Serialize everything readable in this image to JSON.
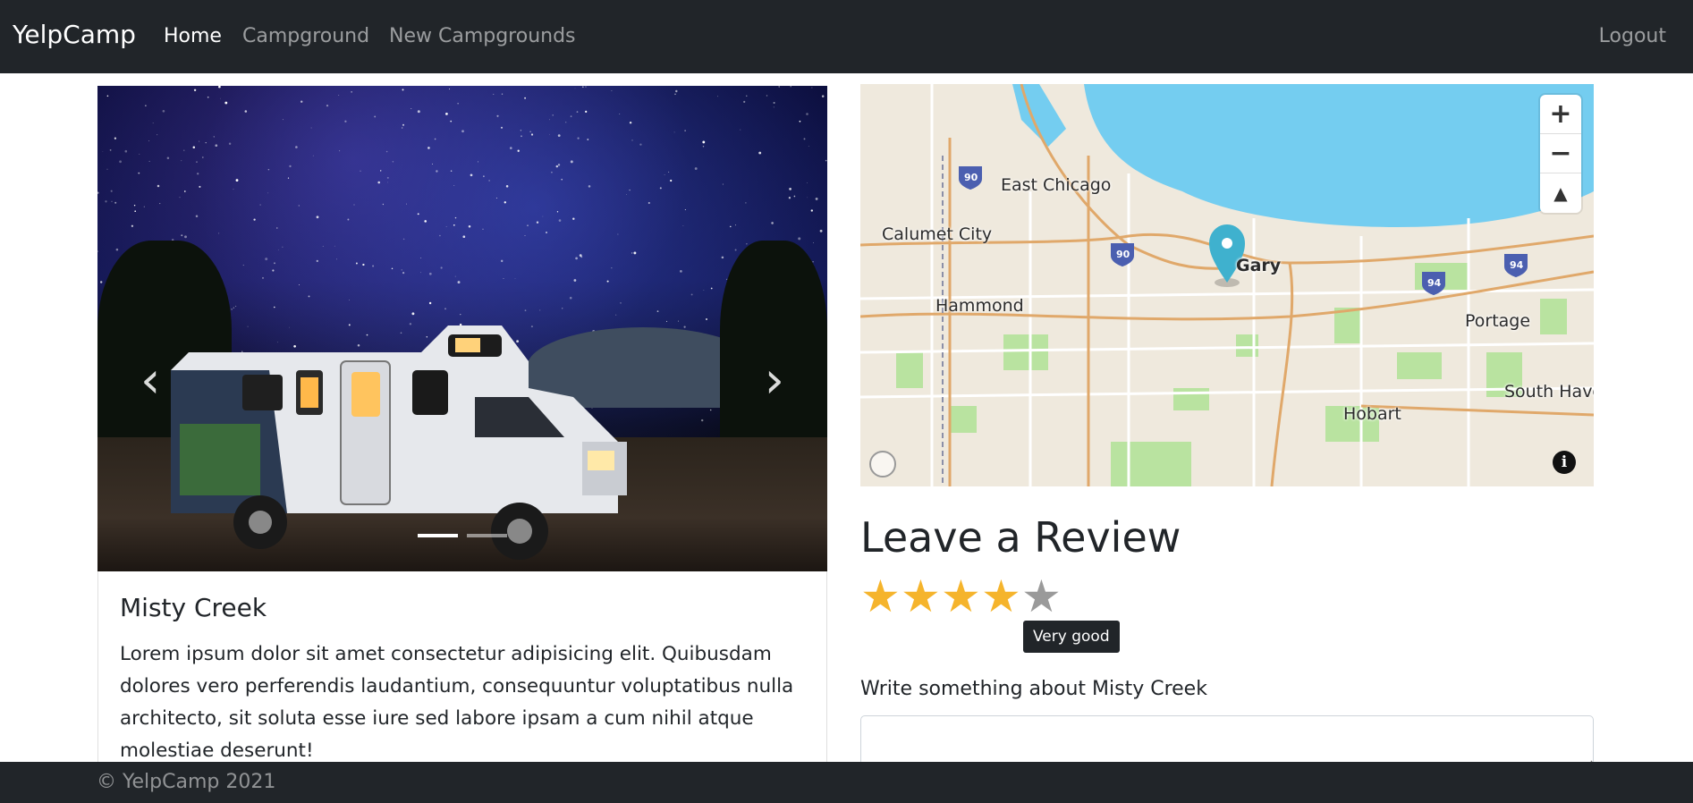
{
  "navbar": {
    "brand": "YelpCamp",
    "links": [
      "Home",
      "Campground",
      "New Campgrounds"
    ],
    "logout": "Logout"
  },
  "campground": {
    "title": "Misty Creek",
    "description": "Lorem ipsum dolor sit amet consectetur adipisicing elit. Quibusdam dolores vero perferendis laudantium, consequuntur voluptatibus nulla architecto, sit soluta esse iure sed labore ipsam a cum nihil atque molestiae deserunt!",
    "carousel": {
      "slide_count": 2,
      "active_slide": 1
    }
  },
  "map": {
    "labels": [
      "East Chicago",
      "Calumet City",
      "Hammond",
      "Gary",
      "Portage",
      "South Haven",
      "Hobart"
    ],
    "shields": [
      "90",
      "90",
      "94",
      "94"
    ],
    "controls": {
      "zoom_in": "+",
      "zoom_out": "−",
      "compass": "▲"
    },
    "info": "i",
    "colors": {
      "water": "#74cdf0",
      "land": "#efe9dd",
      "park": "#b9e3a0",
      "road": "#e0a86a",
      "marker": "#3fb1ce"
    }
  },
  "review": {
    "heading": "Leave a Review",
    "rating": 4,
    "max_rating": 5,
    "rating_tooltip": "Very good",
    "label": "Write something about Misty Creek",
    "star_color": "#f5b42c"
  },
  "footer": {
    "text": "© YelpCamp 2021"
  }
}
